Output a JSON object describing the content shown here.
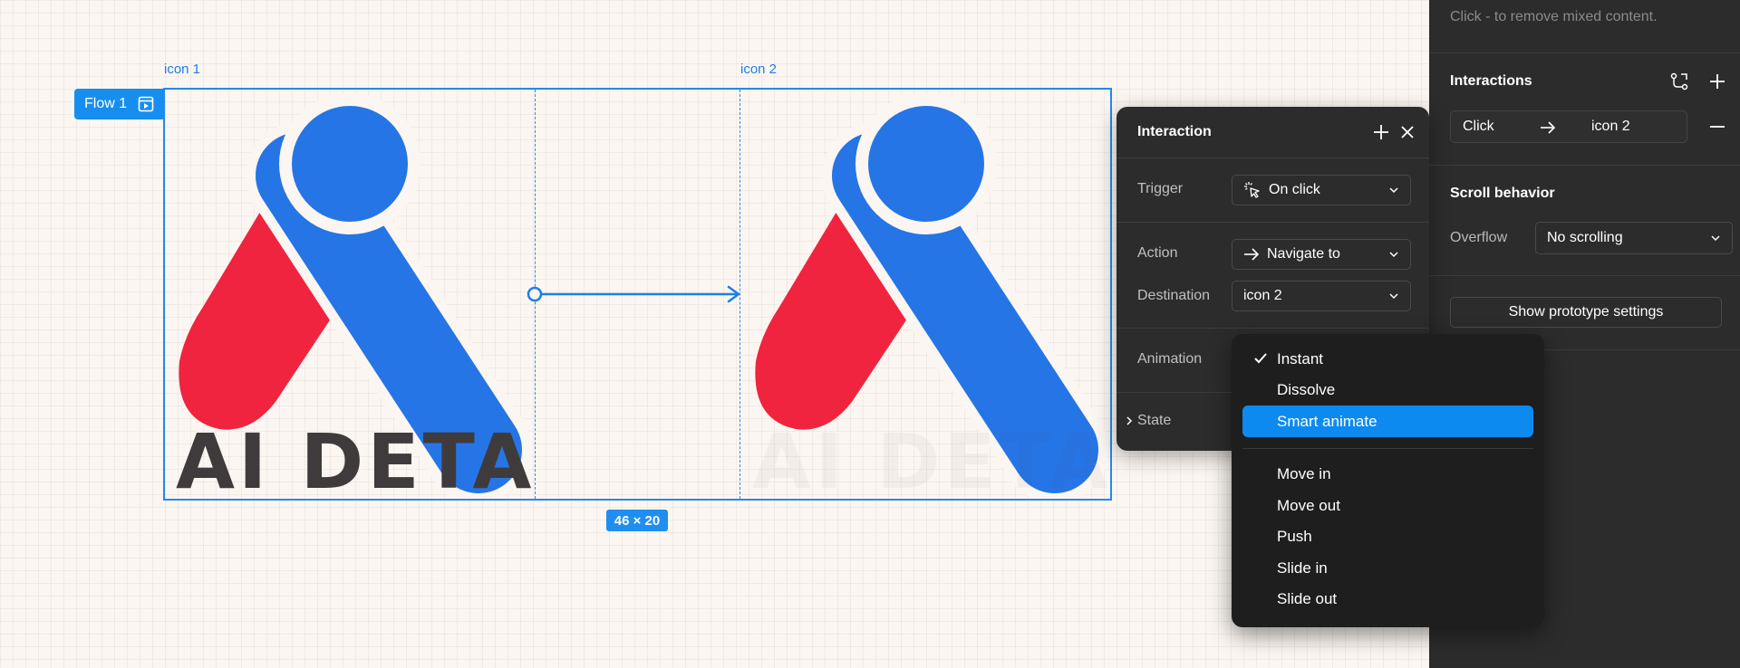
{
  "canvas": {
    "frames": [
      {
        "label": "icon 1"
      },
      {
        "label": "icon 2"
      }
    ],
    "flow_label": "Flow 1",
    "size_badge": "46 × 20",
    "logo_text": "AI DETA",
    "colors": {
      "blue": "#2675e6",
      "red": "#f0243f",
      "text": "#3f3b3d",
      "selection": "#2489ec"
    }
  },
  "panel": {
    "mixed_hint": "Click - to remove mixed content.",
    "interactions_title": "Interactions",
    "interaction_row": {
      "trigger": "Click",
      "target": "icon 2"
    },
    "scroll_title": "Scroll behavior",
    "overflow_label": "Overflow",
    "overflow_value": "No scrolling",
    "prototype_button": "Show prototype settings"
  },
  "popup": {
    "title": "Interaction",
    "trigger_label": "Trigger",
    "trigger_value": "On click",
    "action_label": "Action",
    "action_value": "Navigate to",
    "destination_label": "Destination",
    "destination_value": "icon 2",
    "animation_label": "Animation",
    "state_label": "State"
  },
  "animation_menu": {
    "selected": "Smart animate",
    "checked": "Instant",
    "group1": [
      "Instant",
      "Dissolve",
      "Smart animate"
    ],
    "group2": [
      "Move in",
      "Move out",
      "Push",
      "Slide in",
      "Slide out"
    ]
  }
}
